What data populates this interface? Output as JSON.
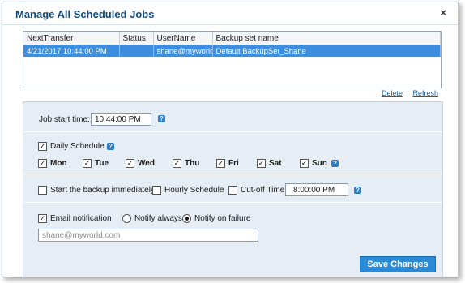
{
  "dialog": {
    "title": "Manage All Scheduled Jobs",
    "close_label": "×"
  },
  "jobs_table": {
    "columns": [
      "NextTransfer",
      "Status",
      "UserName",
      "Backup set name"
    ],
    "rows": [
      {
        "next_transfer": "4/21/2017 10:44:00 PM",
        "status": "",
        "username": "shane@myworld....",
        "backup_set": "Default BackupSet_Shane"
      }
    ]
  },
  "table_actions": {
    "delete": "Delete",
    "refresh": "Refresh"
  },
  "job_start": {
    "label": "Job start time:",
    "value": "10:44:00 PM"
  },
  "daily_schedule": {
    "label": "Daily Schedule",
    "checked": true,
    "days": [
      {
        "label": "Mon",
        "checked": true
      },
      {
        "label": "Tue",
        "checked": true
      },
      {
        "label": "Wed",
        "checked": true
      },
      {
        "label": "Thu",
        "checked": true
      },
      {
        "label": "Fri",
        "checked": true
      },
      {
        "label": "Sat",
        "checked": true
      },
      {
        "label": "Sun",
        "checked": true
      }
    ]
  },
  "options": {
    "start_immediately": "Start the backup immediately",
    "hourly_schedule": "Hourly Schedule",
    "cutoff_time": "Cut-off Time",
    "cutoff_value": "8:00:00 PM"
  },
  "email": {
    "label": "Email notification",
    "checked": true,
    "notify_always": "Notify always",
    "notify_failure": "Notify on failure",
    "selected": "Notify on failure",
    "placeholder": "shane@myworld.com"
  },
  "save_label": "Save Changes",
  "help_glyph": "?",
  "check_glyph": "✓",
  "colors": {
    "title": "#0e4a7d",
    "accent": "#2b8ad6",
    "selection": "#3b8ee0",
    "panel": "#e6edf5"
  }
}
